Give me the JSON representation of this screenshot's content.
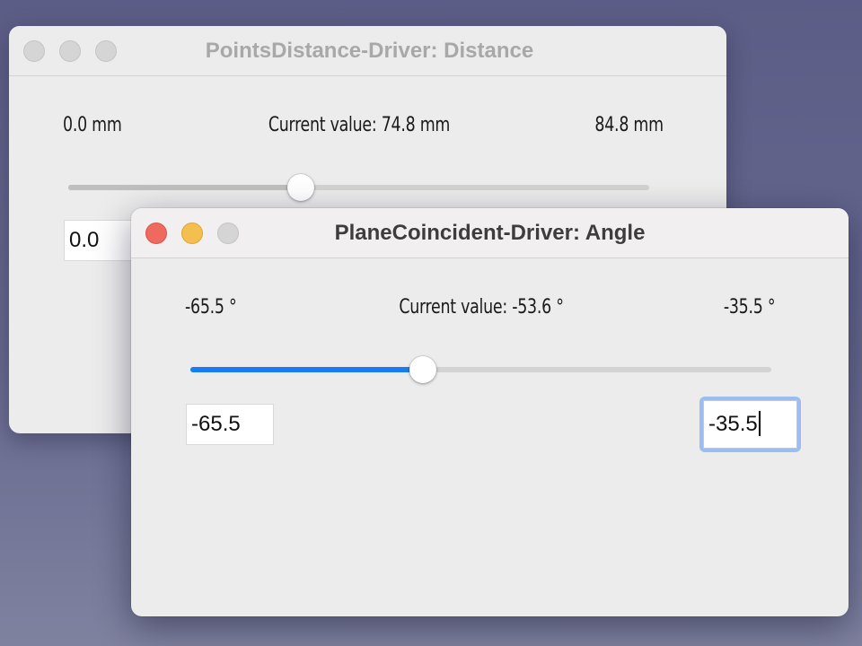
{
  "back_window": {
    "title": "PointsDistance-Driver: Distance",
    "min_label": "0.0  mm",
    "current_label": "Current  value:  74.8  mm",
    "max_label": "84.8  mm",
    "slider_fraction": 0.4,
    "min_field_value": "0.0"
  },
  "front_window": {
    "title": "PlaneCoincident-Driver: Angle",
    "min_label": "-65.5  °",
    "current_label": "Current  value:  -53.6  °",
    "max_label": "-35.5  °",
    "slider_fraction": 0.4,
    "min_field_value": "-65.5",
    "max_field_value": "-35.5"
  },
  "colors": {
    "accent": "#1a7cf5",
    "focus_ring": "#9bbdf0",
    "close_active": "#ee6a5f",
    "minimize_active": "#f4bf4f",
    "inactive_button": "#d5d5d5",
    "back_slider_fill": "#bfbfbf"
  },
  "icons": {
    "close": "close-button-icon",
    "minimize": "minimize-button-icon",
    "zoom": "zoom-button-icon"
  }
}
